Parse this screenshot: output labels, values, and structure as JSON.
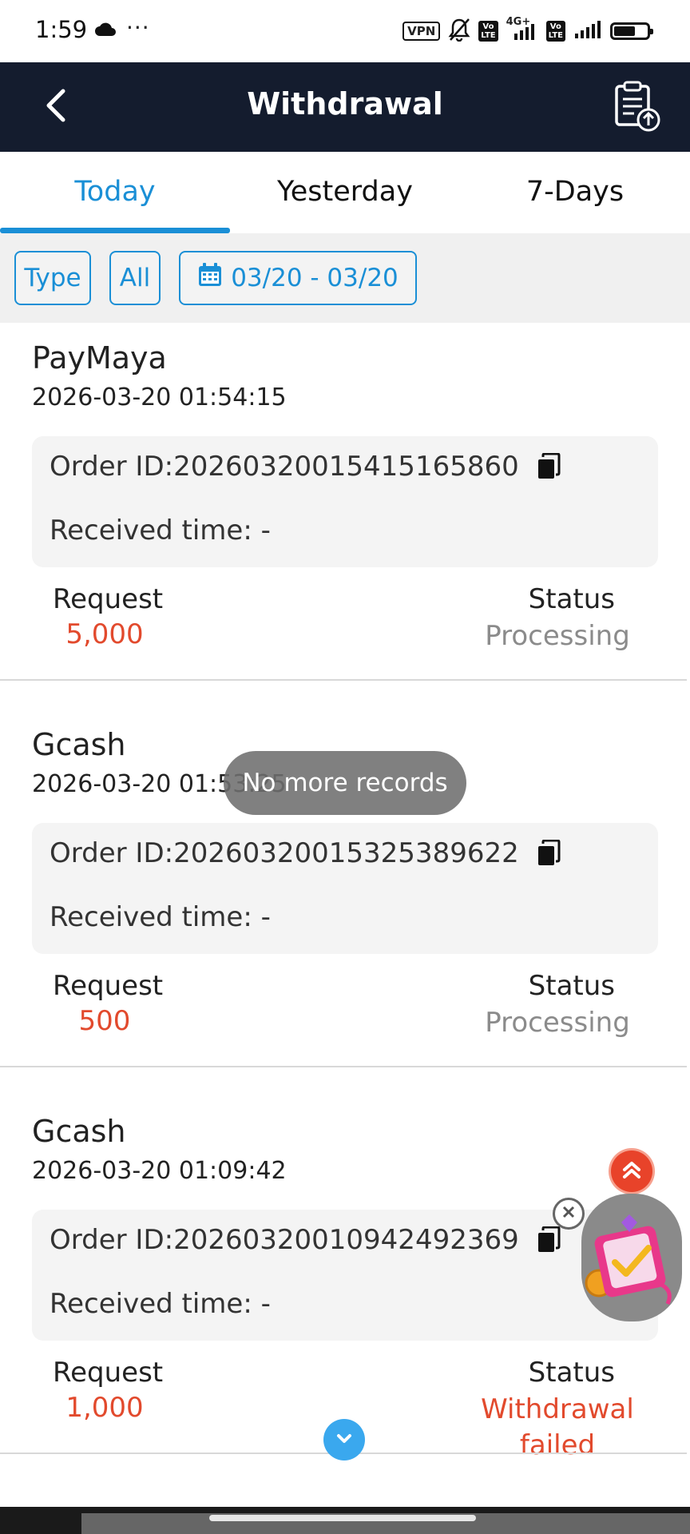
{
  "status_bar": {
    "time": "1:59",
    "dots": "···",
    "vpn": "VPN",
    "net1": "4G+",
    "volte": "Vo LTE"
  },
  "header": {
    "title": "Withdrawal"
  },
  "tabs": [
    {
      "label": "Today",
      "active": true
    },
    {
      "label": "Yesterday",
      "active": false
    },
    {
      "label": "7-Days",
      "active": false
    }
  ],
  "filters": {
    "type_label": "Type",
    "all_label": "All",
    "date_range": "03/20 - 03/20"
  },
  "records": [
    {
      "method": "PayMaya",
      "datetime": "2026-03-20 01:54:15",
      "order_id": "Order ID:20260320015415165860",
      "received": "Received time: -",
      "request_label": "Request",
      "request_value": "5,000",
      "status_label": "Status",
      "status_value": "Processing"
    },
    {
      "method": "Gcash",
      "datetime": "2026-03-20 01:53:25",
      "order_id": "Order ID:20260320015325389622",
      "received": "Received time: -",
      "request_label": "Request",
      "request_value": "500",
      "status_label": "Status",
      "status_value": "Processing"
    },
    {
      "method": "Gcash",
      "datetime": "2026-03-20 01:09:42",
      "order_id": "Order ID:20260320010942492369",
      "received": "Received time: -",
      "request_label": "Request",
      "request_value": "1,000",
      "status_label": "Status",
      "status_value": "Withdrawal failed"
    }
  ],
  "toast": "No more records",
  "colors": {
    "header_bg": "#141c2e",
    "accent": "#1a8fd6",
    "amount": "#e24a2d",
    "status_processing": "#8b8b8b",
    "status_failed": "#e24a2d"
  },
  "icons": [
    "back-arrow-icon",
    "records-clipboard-icon",
    "calendar-icon",
    "copy-icon",
    "double-chevron-up-icon",
    "close-icon",
    "chevron-down-icon"
  ]
}
